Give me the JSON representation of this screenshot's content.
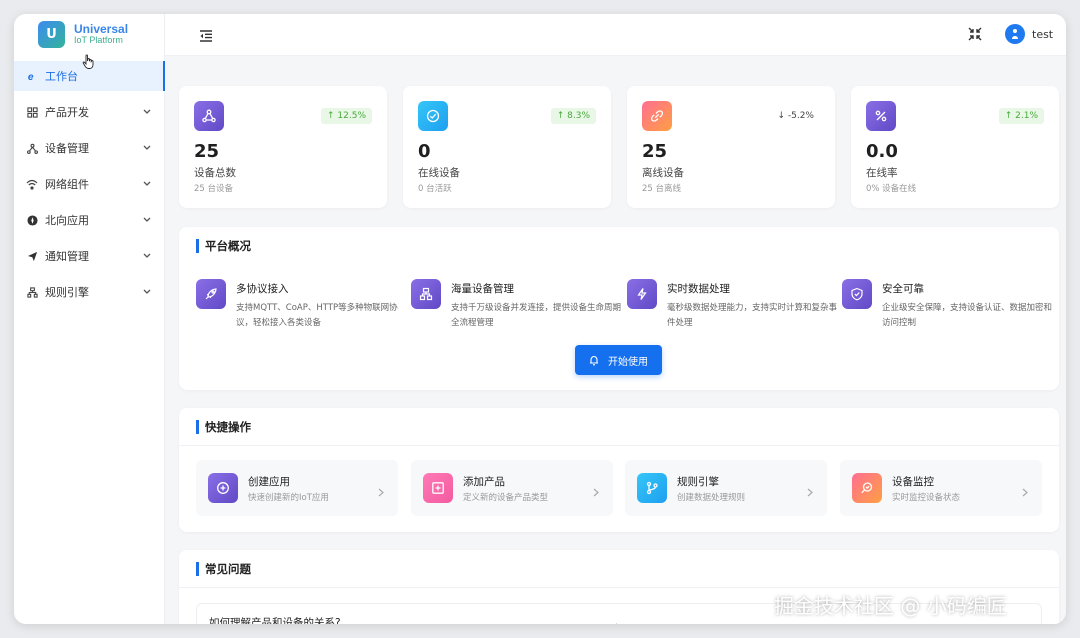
{
  "app": {
    "logo_letter": "U",
    "title": "Universal",
    "subtitle": "IoT Platform"
  },
  "sidebar": {
    "items": [
      {
        "label": "工作台",
        "icon": "home-icon",
        "active": true
      },
      {
        "label": "产品开发",
        "icon": "grid-icon"
      },
      {
        "label": "设备管理",
        "icon": "device-tree-icon"
      },
      {
        "label": "网络组件",
        "icon": "wifi-icon"
      },
      {
        "label": "北向应用",
        "icon": "compass-icon"
      },
      {
        "label": "通知管理",
        "icon": "send-icon"
      },
      {
        "label": "规则引擎",
        "icon": "rules-icon"
      }
    ]
  },
  "header": {
    "user_name": "test"
  },
  "stats": [
    {
      "value": "25",
      "label": "设备总数",
      "sub": "25 台设备",
      "trend": "12.5%",
      "trend_dir": "up",
      "icon": "network-icon",
      "color": "#7b5fd6"
    },
    {
      "value": "0",
      "label": "在线设备",
      "sub": "0 台活跃",
      "trend": "8.3%",
      "trend_dir": "up",
      "icon": "check-circle-icon",
      "color": "#29b8f5"
    },
    {
      "value": "25",
      "label": "离线设备",
      "sub": "25 台离线",
      "trend": "-5.2%",
      "trend_dir": "down",
      "icon": "broken-link-icon",
      "color": "#f76c7b"
    },
    {
      "value": "0.0",
      "label": "在线率",
      "sub": "0% 设备在线",
      "trend": "2.1%",
      "trend_dir": "up",
      "icon": "percent-icon",
      "color": "#7b5fd6"
    }
  ],
  "overview": {
    "title": "平台概况",
    "features": [
      {
        "title": "多协议接入",
        "desc": "支持MQTT、CoAP、HTTP等多种物联网协议，轻松接入各类设备",
        "icon": "rocket-icon"
      },
      {
        "title": "海量设备管理",
        "desc": "支持千万级设备并发连接，提供设备生命周期全流程管理",
        "icon": "cluster-icon"
      },
      {
        "title": "实时数据处理",
        "desc": "毫秒级数据处理能力，支持实时计算和复杂事件处理",
        "icon": "lightning-icon"
      },
      {
        "title": "安全可靠",
        "desc": "企业级安全保障，支持设备认证、数据加密和访问控制",
        "icon": "shield-icon"
      }
    ],
    "start_button": "开始使用"
  },
  "quick_actions": {
    "title": "快捷操作",
    "items": [
      {
        "title": "创建应用",
        "desc": "快速创建新的IoT应用",
        "icon": "plus-circle-icon"
      },
      {
        "title": "添加产品",
        "desc": "定义新的设备产品类型",
        "icon": "plus-square-icon"
      },
      {
        "title": "规则引擎",
        "desc": "创建数据处理规则",
        "icon": "branch-icon"
      },
      {
        "title": "设备监控",
        "desc": "实时监控设备状态",
        "icon": "monitor-icon"
      }
    ]
  },
  "faq": {
    "title": "常见问题",
    "items": [
      {
        "question": "如何理解产品和设备的关系?"
      }
    ]
  },
  "watermark": "掘金技术社区 @ 小码编匠"
}
